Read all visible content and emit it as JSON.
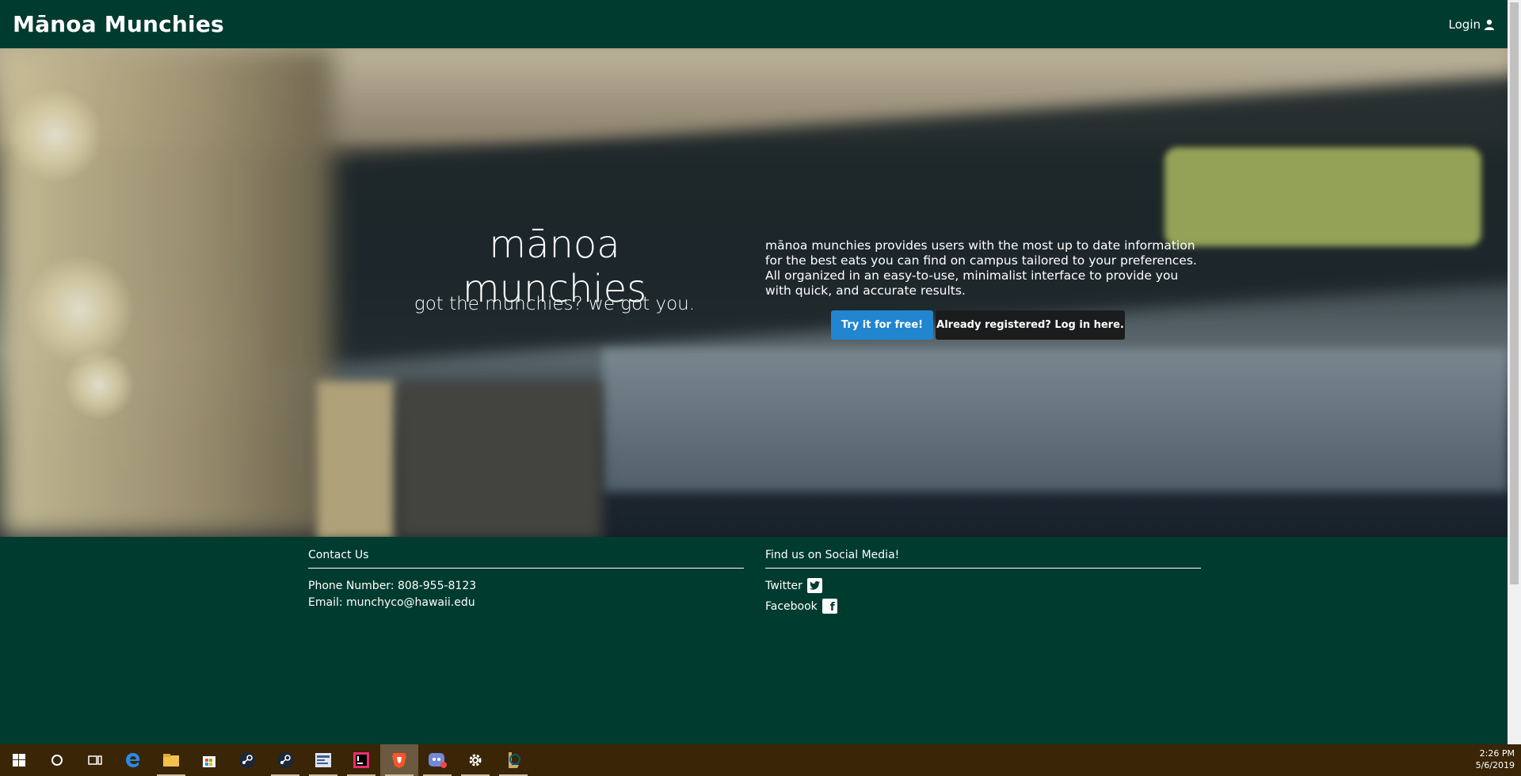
{
  "navbar": {
    "brand": "Mānoa Munchies",
    "login_label": "Login"
  },
  "hero": {
    "title": "mānoa munchies",
    "subtitle": "got the munchies? we got you.",
    "description": "mānoa munchies provides users with the most up to date information for the best eats you can find on campus tailored to your preferences. All organized in an easy-to-use, minimalist interface to provide you with quick, and accurate results.",
    "primary_button": "Try it for free!",
    "secondary_button": "Already registered? Log in here."
  },
  "footer": {
    "contact": {
      "heading": "Contact Us",
      "phone": "Phone Number: 808-955-8123",
      "email": "Email: munchyco@hawaii.edu"
    },
    "social": {
      "heading": "Find us on Social Media!",
      "twitter": "Twitter",
      "facebook": "Facebook"
    }
  },
  "taskbar": {
    "icons": [
      "windows-start-icon",
      "cortana-icon",
      "task-view-icon",
      "edge-icon",
      "file-explorer-icon",
      "store-icon",
      "steam-icon",
      "steam-icon-2",
      "app-icon",
      "intellij-icon",
      "brave-icon",
      "discord-icon",
      "settings-icon",
      "league-icon"
    ],
    "time": "2:26 PM",
    "date": "5/6/2019"
  }
}
